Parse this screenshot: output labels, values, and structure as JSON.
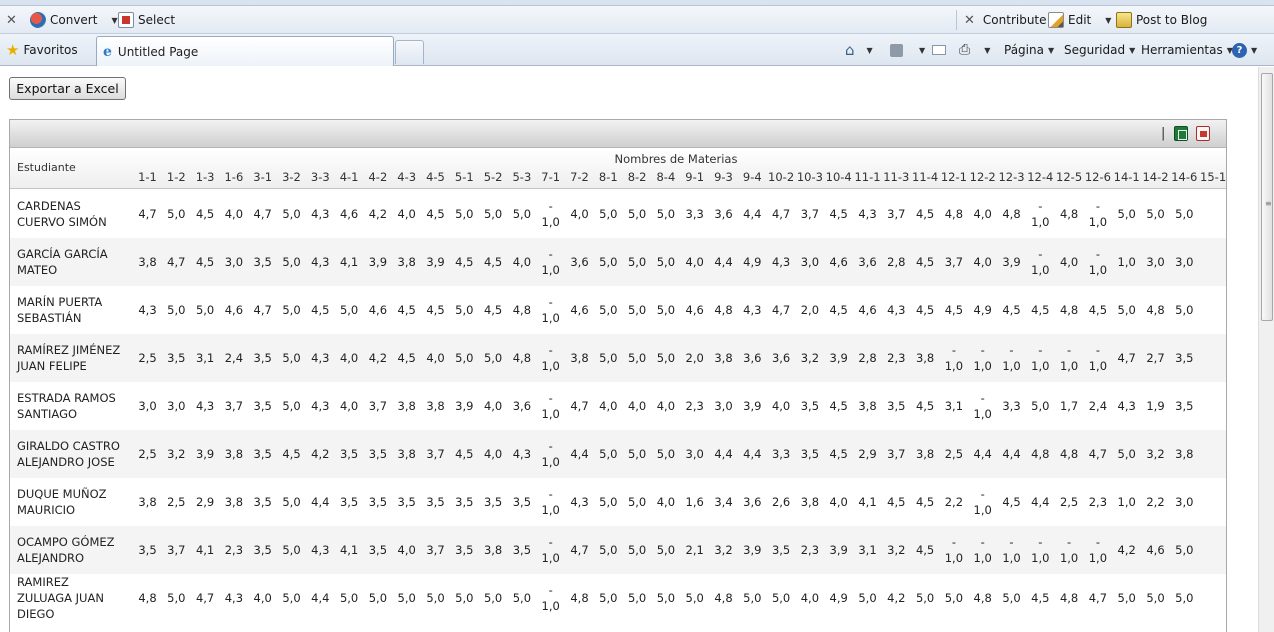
{
  "browser": {
    "toolbar1": {
      "convert_label": "Convert",
      "select_label": "Select",
      "contribute_label": "Contribute",
      "edit_label": "Edit",
      "post_to_blog_label": "Post to Blog"
    },
    "toolbar2": {
      "favorites_label": "Favoritos",
      "tab_title": "Untitled Page",
      "page_menu": "Página",
      "security_menu": "Seguridad",
      "tools_menu": "Herramientas"
    }
  },
  "page": {
    "export_button_label": "Exportar a Excel"
  },
  "grid": {
    "student_header": "Estudiante",
    "group_header": "Nombres de Materias",
    "columns": [
      "1-1",
      "1-2",
      "1-3",
      "1-6",
      "3-1",
      "3-2",
      "3-3",
      "4-1",
      "4-2",
      "4-3",
      "4-5",
      "5-1",
      "5-2",
      "5-3",
      "7-1",
      "7-2",
      "8-1",
      "8-2",
      "8-4",
      "9-1",
      "9-3",
      "9-4",
      "10-2",
      "10-3",
      "10-4",
      "11-1",
      "11-3",
      "11-4",
      "12-1",
      "12-2",
      "12-3",
      "12-4",
      "12-5",
      "12-6",
      "14-1",
      "14-2",
      "14-6",
      "15-1"
    ],
    "rows": [
      {
        "name": [
          "CARDENAS",
          "CUERVO SIMÓN"
        ],
        "values": [
          "4,7",
          "5,0",
          "4,5",
          "4,0",
          "4,7",
          "5,0",
          "4,3",
          "4,6",
          "4,2",
          "4,0",
          "4,5",
          "5,0",
          "5,0",
          "5,0",
          "-\n1,0",
          "4,0",
          "5,0",
          "5,0",
          "5,0",
          "3,3",
          "3,6",
          "4,4",
          "4,7",
          "3,7",
          "4,5",
          "4,3",
          "3,7",
          "4,5",
          "4,8",
          "4,0",
          "4,8",
          "-\n1,0",
          "4,8",
          "-\n1,0",
          "5,0",
          "5,0",
          "5,0",
          ""
        ]
      },
      {
        "name": [
          "GARCÍA GARCÍA",
          "MATEO"
        ],
        "values": [
          "3,8",
          "4,7",
          "4,5",
          "3,0",
          "3,5",
          "5,0",
          "4,3",
          "4,1",
          "3,9",
          "3,8",
          "3,9",
          "4,5",
          "4,5",
          "4,0",
          "-\n1,0",
          "3,6",
          "5,0",
          "5,0",
          "5,0",
          "4,0",
          "4,4",
          "4,9",
          "4,3",
          "3,0",
          "4,6",
          "3,6",
          "2,8",
          "4,5",
          "3,7",
          "4,0",
          "3,9",
          "-\n1,0",
          "4,0",
          "-\n1,0",
          "1,0",
          "3,0",
          "3,0",
          ""
        ]
      },
      {
        "name": [
          "MARÍN PUERTA",
          "SEBASTIÁN"
        ],
        "values": [
          "4,3",
          "5,0",
          "5,0",
          "4,6",
          "4,7",
          "5,0",
          "4,5",
          "5,0",
          "4,6",
          "4,5",
          "4,5",
          "5,0",
          "4,5",
          "4,8",
          "-\n1,0",
          "4,6",
          "5,0",
          "5,0",
          "5,0",
          "4,6",
          "4,8",
          "4,3",
          "4,7",
          "2,0",
          "4,5",
          "4,6",
          "4,3",
          "4,5",
          "4,5",
          "4,9",
          "4,5",
          "4,5",
          "4,8",
          "4,5",
          "5,0",
          "4,8",
          "5,0",
          ""
        ]
      },
      {
        "name": [
          "RAMÍREZ JIMÉNEZ",
          "JUAN FELIPE"
        ],
        "values": [
          "2,5",
          "3,5",
          "3,1",
          "2,4",
          "3,5",
          "5,0",
          "4,3",
          "4,0",
          "4,2",
          "4,5",
          "4,0",
          "5,0",
          "5,0",
          "4,8",
          "-\n1,0",
          "3,8",
          "5,0",
          "5,0",
          "5,0",
          "2,0",
          "3,8",
          "3,6",
          "3,6",
          "3,2",
          "3,9",
          "2,8",
          "2,3",
          "3,8",
          "-\n1,0",
          "-\n1,0",
          "-\n1,0",
          "-\n1,0",
          "-\n1,0",
          "-\n1,0",
          "4,7",
          "2,7",
          "3,5",
          ""
        ]
      },
      {
        "name": [
          "ESTRADA RAMOS",
          "SANTIAGO"
        ],
        "values": [
          "3,0",
          "3,0",
          "4,3",
          "3,7",
          "3,5",
          "5,0",
          "4,3",
          "4,0",
          "3,7",
          "3,8",
          "3,8",
          "3,9",
          "4,0",
          "3,6",
          "-\n1,0",
          "4,7",
          "4,0",
          "4,0",
          "4,0",
          "2,3",
          "3,0",
          "3,9",
          "4,0",
          "3,5",
          "4,5",
          "3,8",
          "3,5",
          "4,5",
          "3,1",
          "-\n1,0",
          "3,3",
          "5,0",
          "1,7",
          "2,4",
          "4,3",
          "1,9",
          "3,5",
          ""
        ]
      },
      {
        "name": [
          "GIRALDO CASTRO",
          "ALEJANDRO JOSE"
        ],
        "values": [
          "2,5",
          "3,2",
          "3,9",
          "3,8",
          "3,5",
          "4,5",
          "4,2",
          "3,5",
          "3,5",
          "3,8",
          "3,7",
          "4,5",
          "4,0",
          "4,3",
          "-\n1,0",
          "4,4",
          "5,0",
          "5,0",
          "5,0",
          "3,0",
          "4,4",
          "4,4",
          "3,3",
          "3,5",
          "4,5",
          "2,9",
          "3,7",
          "3,8",
          "2,5",
          "4,4",
          "4,4",
          "4,8",
          "4,8",
          "4,7",
          "5,0",
          "3,2",
          "3,8",
          ""
        ]
      },
      {
        "name": [
          "DUQUE MUÑOZ",
          "MAURICIO"
        ],
        "values": [
          "3,8",
          "2,5",
          "2,9",
          "3,8",
          "3,5",
          "5,0",
          "4,4",
          "3,5",
          "3,5",
          "3,5",
          "3,5",
          "3,5",
          "3,5",
          "3,5",
          "-\n1,0",
          "4,3",
          "5,0",
          "5,0",
          "4,0",
          "1,6",
          "3,4",
          "3,6",
          "2,6",
          "3,8",
          "4,0",
          "4,1",
          "4,5",
          "4,5",
          "2,2",
          "-\n1,0",
          "4,5",
          "4,4",
          "2,5",
          "2,3",
          "1,0",
          "2,2",
          "3,0",
          ""
        ]
      },
      {
        "name": [
          "OCAMPO GÓMEZ",
          "ALEJANDRO"
        ],
        "values": [
          "3,5",
          "3,7",
          "4,1",
          "2,3",
          "3,5",
          "5,0",
          "4,3",
          "4,1",
          "3,5",
          "4,0",
          "3,7",
          "3,5",
          "3,8",
          "3,5",
          "-\n1,0",
          "4,7",
          "5,0",
          "5,0",
          "5,0",
          "2,1",
          "3,2",
          "3,9",
          "3,5",
          "2,3",
          "3,9",
          "3,1",
          "3,2",
          "4,5",
          "-\n1,0",
          "-\n1,0",
          "-\n1,0",
          "-\n1,0",
          "-\n1,0",
          "-\n1,0",
          "4,2",
          "4,6",
          "5,0",
          ""
        ]
      },
      {
        "name": [
          "RAMIREZ",
          "ZULUAGA JUAN",
          "DIEGO"
        ],
        "values": [
          "4,8",
          "5,0",
          "4,7",
          "4,3",
          "4,0",
          "5,0",
          "4,4",
          "5,0",
          "5,0",
          "5,0",
          "5,0",
          "5,0",
          "5,0",
          "5,0",
          "-\n1,0",
          "4,8",
          "5,0",
          "5,0",
          "5,0",
          "5,0",
          "4,8",
          "5,0",
          "5,0",
          "4,0",
          "4,9",
          "5,0",
          "4,2",
          "5,0",
          "5,0",
          "4,8",
          "5,0",
          "4,5",
          "4,8",
          "4,7",
          "5,0",
          "5,0",
          "5,0",
          ""
        ]
      }
    ]
  }
}
